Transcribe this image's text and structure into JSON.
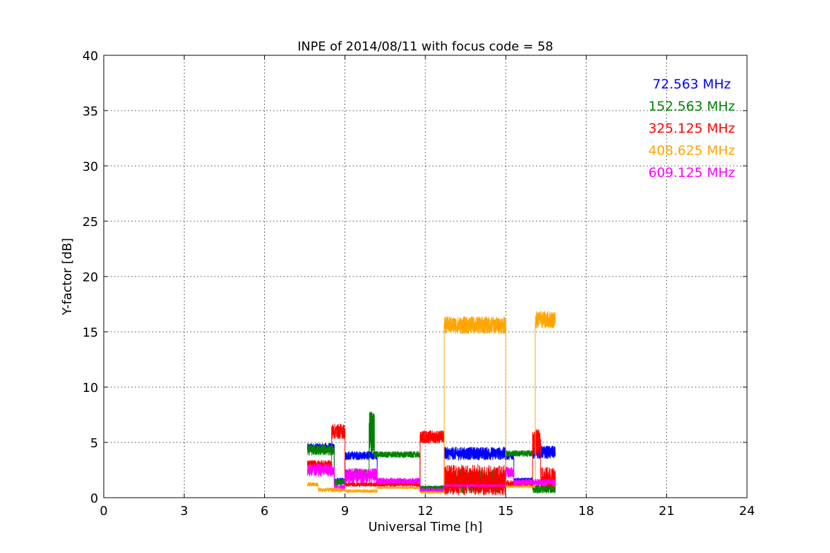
{
  "chart_data": {
    "type": "line",
    "title": "INPE of 2014/08/11 with focus code = 58",
    "xlabel": "Universal Time [h]",
    "ylabel": "Y-factor [dB]",
    "xlim": [
      0,
      24
    ],
    "ylim": [
      0,
      40
    ],
    "xticks": [
      0,
      3,
      6,
      9,
      12,
      15,
      18,
      21,
      24
    ],
    "yticks": [
      0,
      5,
      10,
      15,
      20,
      25,
      30,
      35,
      40
    ],
    "grid": true,
    "legend_position": "top-right",
    "series": [
      {
        "name": "72.563 MHz",
        "color": "#0000ff",
        "segments": [
          {
            "x": [
              7.6,
              8.6
            ],
            "y": 4.5,
            "noise": 0.45
          },
          {
            "x": [
              8.6,
              9.0
            ],
            "y": 1.5,
            "noise": 0.3
          },
          {
            "x": [
              9.0,
              10.2
            ],
            "y": 3.8,
            "noise": 0.4
          },
          {
            "x": [
              10.2,
              11.8
            ],
            "y": 1.4,
            "noise": 0.3
          },
          {
            "x": [
              11.8,
              12.7
            ],
            "y": 0.8,
            "noise": 0.25
          },
          {
            "x": [
              12.7,
              15.0
            ],
            "y": 4.0,
            "noise": 0.6
          },
          {
            "x": [
              15.0,
              15.3
            ],
            "y": 3.8,
            "noise": 0.4
          },
          {
            "x": [
              15.3,
              16.0
            ],
            "y": 1.6,
            "noise": 0.2
          },
          {
            "x": [
              16.0,
              16.85
            ],
            "y": 4.1,
            "noise": 0.6
          }
        ]
      },
      {
        "name": "152.563 MHz",
        "color": "#008000",
        "segments": [
          {
            "x": [
              7.6,
              8.6
            ],
            "y": 4.3,
            "noise": 0.5
          },
          {
            "x": [
              8.6,
              9.0
            ],
            "y": 1.4,
            "noise": 0.3
          },
          {
            "x": [
              9.0,
              9.9
            ],
            "y": 2.2,
            "noise": 0.4
          },
          {
            "x": [
              9.9,
              10.1
            ],
            "y": 6.0,
            "noise": 2.0
          },
          {
            "x": [
              10.1,
              11.8
            ],
            "y": 3.9,
            "noise": 0.3
          },
          {
            "x": [
              11.8,
              12.7
            ],
            "y": 0.9,
            "noise": 0.2
          },
          {
            "x": [
              12.7,
              15.0
            ],
            "y": 1.5,
            "noise": 1.1
          },
          {
            "x": [
              15.0,
              16.0
            ],
            "y": 4.0,
            "noise": 0.3
          },
          {
            "x": [
              16.0,
              16.85
            ],
            "y": 0.8,
            "noise": 0.4
          }
        ]
      },
      {
        "name": "325.125 MHz",
        "color": "#ff0000",
        "segments": [
          {
            "x": [
              7.6,
              8.5
            ],
            "y": 3.0,
            "noise": 0.4
          },
          {
            "x": [
              8.5,
              9.0
            ],
            "y": 6.0,
            "noise": 0.7
          },
          {
            "x": [
              9.0,
              11.8
            ],
            "y": 1.2,
            "noise": 0.2
          },
          {
            "x": [
              11.8,
              12.7
            ],
            "y": 5.5,
            "noise": 0.6
          },
          {
            "x": [
              12.7,
              15.0
            ],
            "y": 1.6,
            "noise": 1.4
          },
          {
            "x": [
              15.0,
              16.0
            ],
            "y": 1.3,
            "noise": 0.3
          },
          {
            "x": [
              16.0,
              16.3
            ],
            "y": 5.0,
            "noise": 1.2
          },
          {
            "x": [
              16.3,
              16.85
            ],
            "y": 1.8,
            "noise": 1.0
          }
        ]
      },
      {
        "name": "408.625 MHz",
        "color": "#ffa500",
        "segments": [
          {
            "x": [
              7.6,
              8.0
            ],
            "y": 1.2,
            "noise": 0.2
          },
          {
            "x": [
              8.0,
              9.0
            ],
            "y": 0.7,
            "noise": 0.2
          },
          {
            "x": [
              9.0,
              10.2
            ],
            "y": 0.6,
            "noise": 0.15
          },
          {
            "x": [
              10.2,
              11.8
            ],
            "y": 0.9,
            "noise": 0.1
          },
          {
            "x": [
              11.8,
              12.7
            ],
            "y": 0.5,
            "noise": 0.1
          },
          {
            "x": [
              12.7,
              15.0
            ],
            "y": 15.6,
            "noise": 0.8
          },
          {
            "x": [
              15.0,
              16.1
            ],
            "y": 1.0,
            "noise": 0.1
          },
          {
            "x": [
              16.1,
              16.85
            ],
            "y": 16.1,
            "noise": 0.8
          }
        ]
      },
      {
        "name": "609.125 MHz",
        "color": "#ff00ff",
        "segments": [
          {
            "x": [
              7.6,
              8.6
            ],
            "y": 2.5,
            "noise": 0.6
          },
          {
            "x": [
              8.6,
              9.0
            ],
            "y": 1.0,
            "noise": 0.2
          },
          {
            "x": [
              9.0,
              10.2
            ],
            "y": 2.0,
            "noise": 0.7
          },
          {
            "x": [
              10.2,
              11.8
            ],
            "y": 1.5,
            "noise": 0.3
          },
          {
            "x": [
              11.8,
              12.7
            ],
            "y": 0.7,
            "noise": 0.15
          },
          {
            "x": [
              12.7,
              15.0
            ],
            "y": 1.1,
            "noise": 0.1
          },
          {
            "x": [
              15.0,
              15.3
            ],
            "y": 2.3,
            "noise": 0.5
          },
          {
            "x": [
              15.3,
              16.85
            ],
            "y": 1.4,
            "noise": 0.3
          }
        ]
      }
    ]
  }
}
